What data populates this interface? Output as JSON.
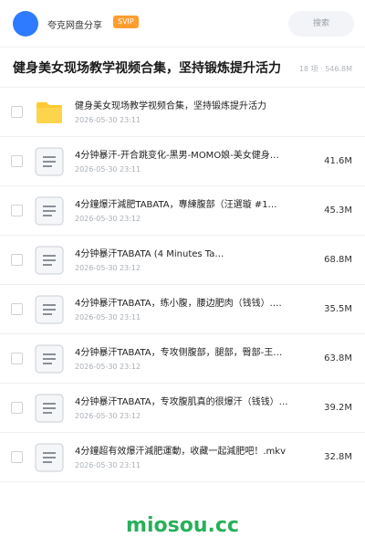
{
  "header": {
    "title": "夸克网盘分享",
    "badge": "SVIP",
    "search_placeholder": "搜索"
  },
  "folder": {
    "title": "健身美女现场教学视频合集，坚持锻炼提升活力",
    "meta": "18 项 · 546.8M"
  },
  "files": [
    {
      "name": "健身美女现场教学视频合集，坚持锻炼提升活力",
      "date": "2026-05-30 23:11",
      "size": "",
      "type": "folder-icon"
    },
    {
      "name": "4分钟暴汗-开合跳变化-黑男-MOMO娘-美女健身…",
      "date": "2026-05-30 23:11",
      "size": "41.6M",
      "type": "document-icon"
    },
    {
      "name": "4分鐘爆汗減肥TABATA，專練腹部（汪選璇 #1…",
      "date": "2026-05-30 23:12",
      "size": "45.3M",
      "type": "document-icon"
    },
    {
      "name": "4分钟暴汗TABATA (4 Minutes Ta…",
      "date": "2026-05-30 23:12",
      "size": "68.8M",
      "type": "document-icon"
    },
    {
      "name": "4分钟暴汗TABATA，练小腹，腰边肥肉（钱钱）.…",
      "date": "2026-05-30 23:11",
      "size": "35.5M",
      "type": "document-icon"
    },
    {
      "name": "4分钟暴汗TABATA，专攻侧腹部，腿部，臀部-王…",
      "date": "2026-05-30 23:12",
      "size": "63.8M",
      "type": "document-icon"
    },
    {
      "name": "4分钟暴汗TABATA，专攻腹肌真的很爆汗（钱钱）…",
      "date": "2026-05-30 23:12",
      "size": "39.2M",
      "type": "document-icon"
    },
    {
      "name": "4分鐘超有效爆汗減肥運動，收藏一起減肥吧！.mkv",
      "date": "2026-05-30 23:11",
      "size": "32.8M",
      "type": "document-icon"
    }
  ],
  "watermark": "miosou.cc",
  "colors": {
    "accent": "#2f7bff",
    "badge": "#ff9d2e",
    "folder": "#ffc933",
    "watermark": "#27b05a"
  }
}
